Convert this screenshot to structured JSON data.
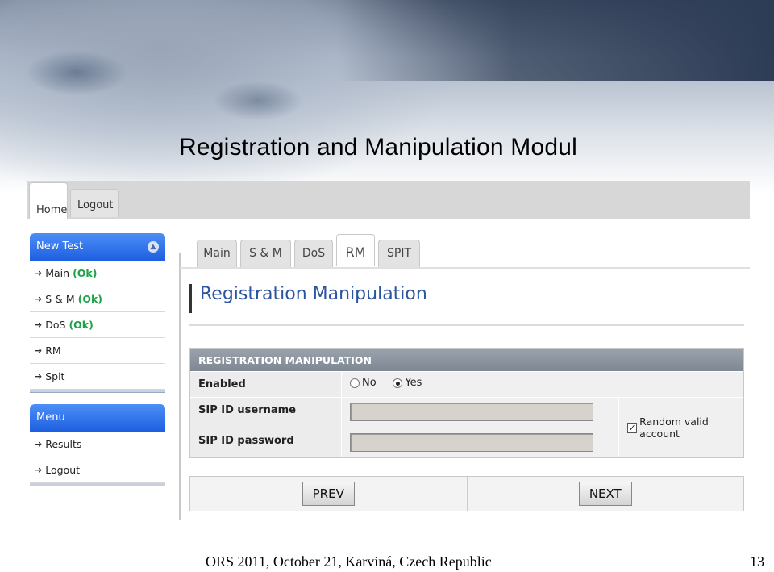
{
  "slide": {
    "title": "Registration and Manipulation Modul",
    "footer": "ORS 2011,  October 21,  Karviná, Czech Republic",
    "page_number": "13"
  },
  "top_tabs": [
    {
      "label": "Home",
      "active": true
    },
    {
      "label": "Logout",
      "active": false
    }
  ],
  "new_test_panel": {
    "title": "New Test",
    "items": [
      {
        "label": "Main",
        "status": "(Ok)"
      },
      {
        "label": "S & M",
        "status": "(Ok)"
      },
      {
        "label": "DoS",
        "status": "(Ok)"
      },
      {
        "label": "RM",
        "status": ""
      },
      {
        "label": "Spit",
        "status": ""
      }
    ]
  },
  "menu_panel": {
    "title": "Menu",
    "items": [
      {
        "label": "Results"
      },
      {
        "label": "Logout"
      }
    ]
  },
  "sub_tabs": [
    {
      "label": "Main"
    },
    {
      "label": "S & M"
    },
    {
      "label": "DoS"
    },
    {
      "label": "RM",
      "active": true
    },
    {
      "label": "SPIT"
    }
  ],
  "page_heading": "Registration Manipulation",
  "form": {
    "header": "REGISTRATION MANIPULATION",
    "enabled_label": "Enabled",
    "option_no": "No",
    "option_yes": "Yes",
    "selected": "Yes",
    "username_label": "SIP ID username",
    "username_value": "",
    "password_label": "SIP ID password",
    "password_value": "",
    "random_label": "Random valid account",
    "random_checked": true
  },
  "nav": {
    "prev": "PREV",
    "next": "NEXT"
  },
  "colors": {
    "panel_header": "#2b6cee",
    "ok_status": "#1ea34a",
    "heading_text": "#2b55a0"
  }
}
